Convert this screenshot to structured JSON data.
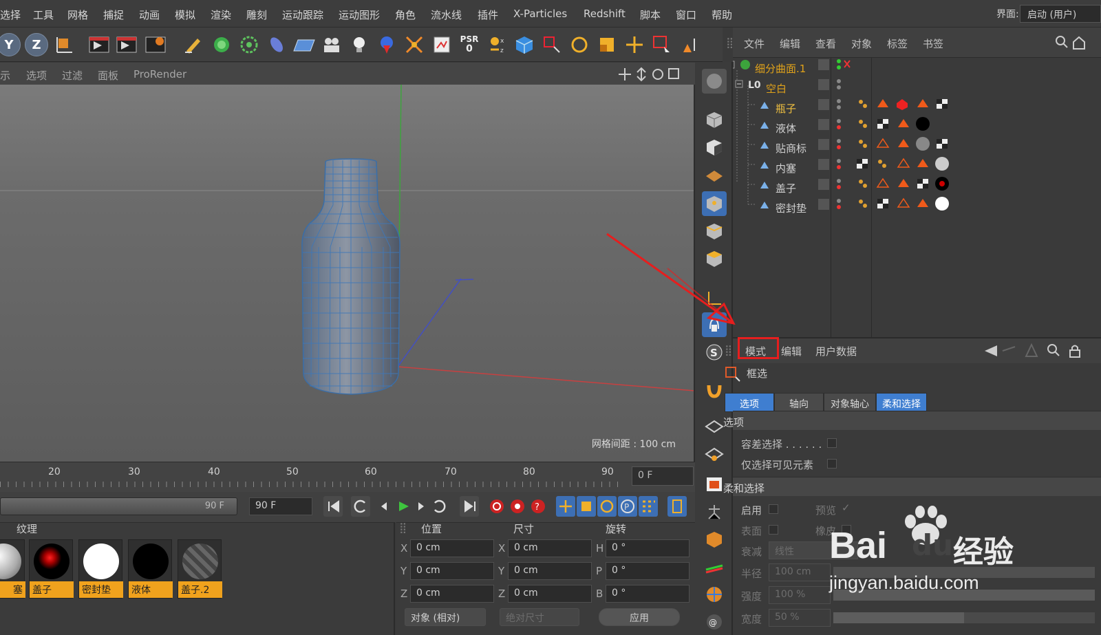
{
  "menubar": {
    "items": [
      "选择",
      "工具",
      "网格",
      "捕捉",
      "动画",
      "模拟",
      "渲染",
      "雕刻",
      "运动跟踪",
      "运动图形",
      "角色",
      "流水线",
      "插件",
      "X-Particles",
      "Redshift",
      "脚本",
      "窗口",
      "帮助"
    ],
    "interface_label": "界面:",
    "interface_value": "启动 (用户)"
  },
  "toolbar": {
    "axis_y": "Y",
    "axis_z": "Z",
    "psr_label": "PSR",
    "psr_value": "0",
    "icons": [
      "axis-y-icon",
      "axis-z-icon",
      "coord-system-icon",
      "render-view-icon",
      "render-picture-icon",
      "render-settings-icon",
      "pen-icon",
      "cube-primitive-icon",
      "subdivision-icon",
      "spline-icon",
      "plane-icon",
      "camera-icon",
      "light-icon",
      "material-icon",
      "deformer-icon",
      "scene-icon",
      "psr-icon",
      "axis-lock-icon",
      "cube-icon",
      "selection-icon",
      "rotate-icon",
      "scale-icon",
      "move-icon",
      "rectangle-select-icon",
      "snap-icon"
    ]
  },
  "viewport": {
    "menu": [
      "示",
      "选项",
      "过滤",
      "面板",
      "ProRender"
    ],
    "grid_spacing": "网格间距 : 100 cm"
  },
  "timeline": {
    "ticks": [
      "20",
      "30",
      "40",
      "50",
      "60",
      "70",
      "80",
      "90"
    ],
    "current_frame": "0 F",
    "end_frame_slider": "90 F",
    "end_frame": "90 F"
  },
  "materials": {
    "tab_label": "纹理",
    "items": [
      {
        "name": "塞"
      },
      {
        "name": "盖子"
      },
      {
        "name": "密封垫"
      },
      {
        "name": "液体"
      },
      {
        "name": "盖子.2"
      }
    ]
  },
  "coordinates": {
    "headers": {
      "position": "位置",
      "size": "尺寸",
      "rotation": "旋转"
    },
    "rows": [
      {
        "axis": "X",
        "pos": "0 cm",
        "size_axis": "X",
        "size": "0 cm",
        "rot_axis": "H",
        "rot": "0 °"
      },
      {
        "axis": "Y",
        "pos": "0 cm",
        "size_axis": "Y",
        "size": "0 cm",
        "rot_axis": "P",
        "rot": "0 °"
      },
      {
        "axis": "Z",
        "pos": "0 cm",
        "size_axis": "Z",
        "size": "0 cm",
        "rot_axis": "B",
        "rot": "0 °"
      }
    ],
    "mode_dropdown": "对象 (相对)",
    "size_dropdown": "绝对尺寸",
    "apply_button": "应用"
  },
  "object_manager": {
    "menu": [
      "文件",
      "编辑",
      "查看",
      "对象",
      "标签",
      "书签"
    ],
    "objects": [
      {
        "name": "细分曲面.1",
        "color": "#e0a21a"
      },
      {
        "name": "空白",
        "color": "#e0a21a"
      },
      {
        "name": "瓶子",
        "color": "#f0c040"
      },
      {
        "name": "液体",
        "color": "#d0d0d0"
      },
      {
        "name": "贴商标",
        "color": "#d0d0d0"
      },
      {
        "name": "内塞",
        "color": "#d0d0d0"
      },
      {
        "name": "盖子",
        "color": "#d0d0d0"
      },
      {
        "name": "密封垫",
        "color": "#d0d0d0"
      }
    ]
  },
  "attribute_manager": {
    "menu": {
      "mode": "模式",
      "edit": "编辑",
      "user_data": "用户数据"
    },
    "tool_name": "框选",
    "tabs": [
      "选项",
      "轴向",
      "对象轴心",
      "柔和选择"
    ],
    "section_options": "选项",
    "tolerance_select": "容差选择 . . . . . .",
    "only_visible": "仅选择可见元素",
    "section_soft": "柔和选择",
    "enable": "启用",
    "preview": "预览",
    "preview_check": "✓",
    "surface": "表面",
    "rubber": "橡皮",
    "falloff": "衰减",
    "falloff_value": "线性",
    "radius": "半径",
    "radius_value": "100 cm",
    "strength": "强度",
    "strength_value": "100 %",
    "width": "宽度",
    "width_value": "50 %"
  },
  "watermark": {
    "brand": "Bai",
    "brand2": "du",
    "brand_cn": "经验",
    "url": "jingyan.baidu.com"
  },
  "colors": {
    "accent": "#e61e1e",
    "selection_blue": "#3f82d8",
    "material_label": "#f0a21d"
  }
}
